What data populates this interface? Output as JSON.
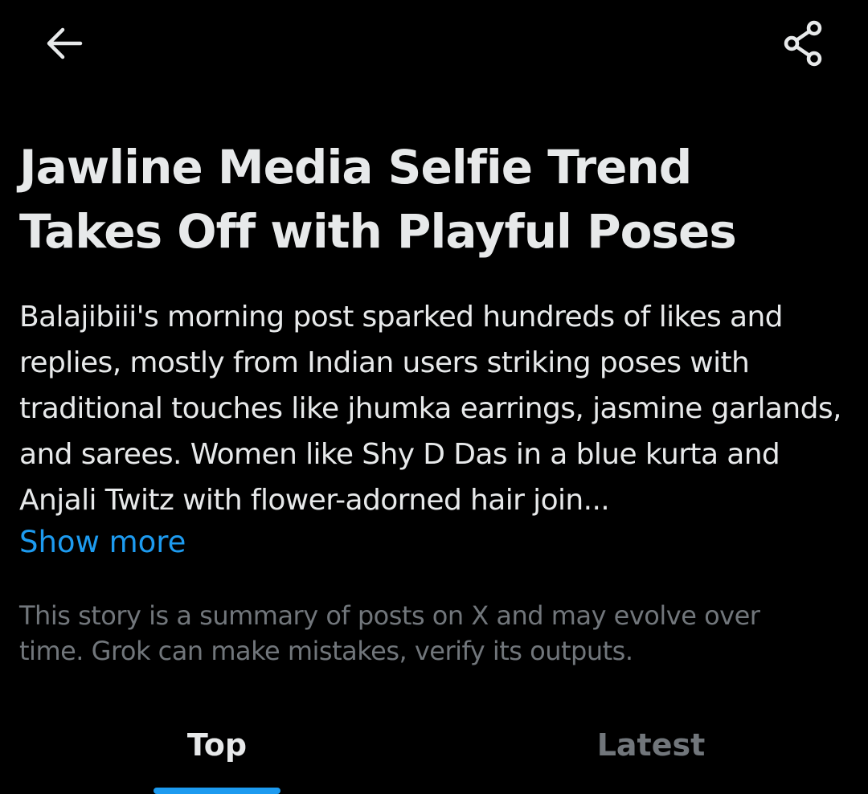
{
  "header": {
    "back_icon": "arrow-left-icon",
    "share_icon": "share-icon"
  },
  "story": {
    "title": "Jawline Media Selfie Trend Takes Off with Playful Poses",
    "summary": "Balajibiii's morning post sparked hundreds of likes and replies, mostly from Indian users striking poses with traditional touches like jhumka earrings, jasmine garlands, and sarees. Women like Shy D Das in a blue kurta and Anjali Twitz with flower-adorned hair join...",
    "show_more_label": "Show more",
    "disclaimer": "This story is a summary of posts on X and may evolve over time. Grok can make mistakes, verify its outputs."
  },
  "tabs": [
    {
      "label": "Top",
      "active": true
    },
    {
      "label": "Latest",
      "active": false
    }
  ],
  "colors": {
    "background": "#000000",
    "primary_text": "#e7e9ea",
    "secondary_text": "#71767b",
    "accent": "#1d9bf0"
  }
}
